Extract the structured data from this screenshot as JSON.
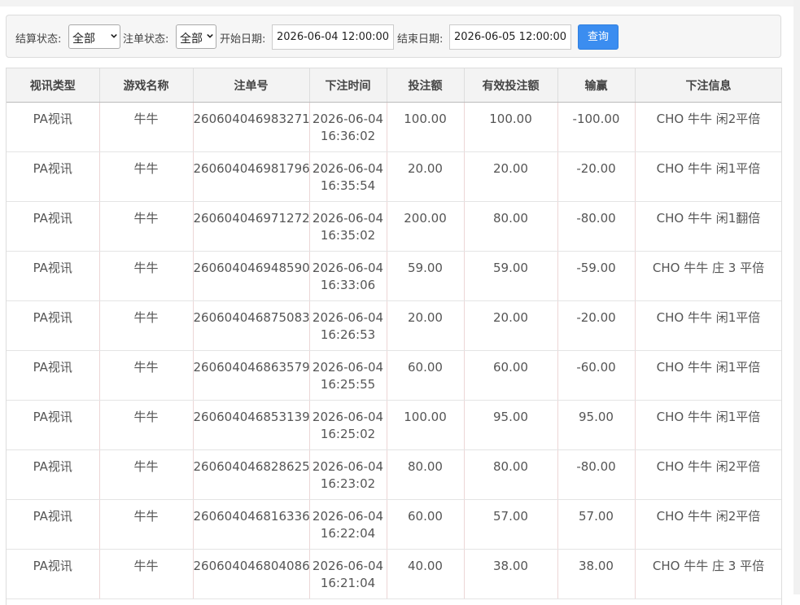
{
  "filters": {
    "settle_label": "结算状态:",
    "settle_value": "全部",
    "bet_status_label": "注单状态:",
    "bet_status_value": "全部",
    "start_label": "开始日期:",
    "start_value": "2026-06-04 12:00:00",
    "end_label": "结束日期:",
    "end_value": "2026-06-05 12:00:00",
    "query_label": "查询"
  },
  "table": {
    "headers": [
      "视讯类型",
      "游戏名称",
      "注单号",
      "下注时间",
      "投注额",
      "有效投注额",
      "输赢",
      "下注信息"
    ],
    "rows": [
      {
        "type": "PA视讯",
        "game": "牛牛",
        "id": "260604046983271",
        "date": "2026-06-04",
        "time": "16:36:02",
        "bet": "100.00",
        "valid": "100.00",
        "winloss": "-100.00",
        "info": "CHO 牛牛 闲2平倍"
      },
      {
        "type": "PA视讯",
        "game": "牛牛",
        "id": "260604046981796",
        "date": "2026-06-04",
        "time": "16:35:54",
        "bet": "20.00",
        "valid": "20.00",
        "winloss": "-20.00",
        "info": "CHO 牛牛 闲1平倍"
      },
      {
        "type": "PA视讯",
        "game": "牛牛",
        "id": "260604046971272",
        "date": "2026-06-04",
        "time": "16:35:02",
        "bet": "200.00",
        "valid": "80.00",
        "winloss": "-80.00",
        "info": "CHO 牛牛 闲1翻倍"
      },
      {
        "type": "PA视讯",
        "game": "牛牛",
        "id": "260604046948590",
        "date": "2026-06-04",
        "time": "16:33:06",
        "bet": "59.00",
        "valid": "59.00",
        "winloss": "-59.00",
        "info": "CHO 牛牛 庄 3 平倍"
      },
      {
        "type": "PA视讯",
        "game": "牛牛",
        "id": "260604046875083",
        "date": "2026-06-04",
        "time": "16:26:53",
        "bet": "20.00",
        "valid": "20.00",
        "winloss": "-20.00",
        "info": "CHO 牛牛 闲1平倍"
      },
      {
        "type": "PA视讯",
        "game": "牛牛",
        "id": "260604046863579",
        "date": "2026-06-04",
        "time": "16:25:55",
        "bet": "60.00",
        "valid": "60.00",
        "winloss": "-60.00",
        "info": "CHO 牛牛 闲1平倍"
      },
      {
        "type": "PA视讯",
        "game": "牛牛",
        "id": "260604046853139",
        "date": "2026-06-04",
        "time": "16:25:02",
        "bet": "100.00",
        "valid": "95.00",
        "winloss": "95.00",
        "info": "CHO 牛牛 闲1平倍"
      },
      {
        "type": "PA视讯",
        "game": "牛牛",
        "id": "260604046828625",
        "date": "2026-06-04",
        "time": "16:23:02",
        "bet": "80.00",
        "valid": "80.00",
        "winloss": "-80.00",
        "info": "CHO 牛牛 闲2平倍"
      },
      {
        "type": "PA视讯",
        "game": "牛牛",
        "id": "260604046816336",
        "date": "2026-06-04",
        "time": "16:22:04",
        "bet": "60.00",
        "valid": "57.00",
        "winloss": "57.00",
        "info": "CHO 牛牛 闲2平倍"
      },
      {
        "type": "PA视讯",
        "game": "牛牛",
        "id": "260604046804086",
        "date": "2026-06-04",
        "time": "16:21:04",
        "bet": "40.00",
        "valid": "38.00",
        "winloss": "38.00",
        "info": "CHO 牛牛 庄 3 平倍"
      }
    ]
  }
}
